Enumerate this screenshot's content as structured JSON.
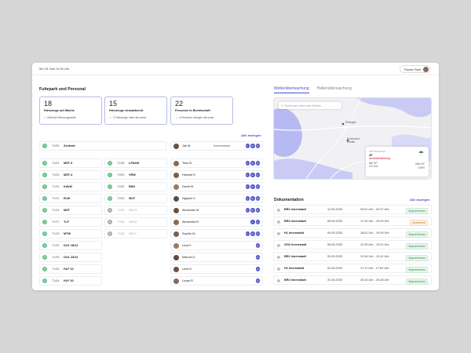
{
  "header": {
    "datetime": "Mo 15. Mai  14:40 Uhr",
    "user": "Florian Seel"
  },
  "fleet": {
    "title": "Fuhrpark und Personal",
    "link_all": "Alle anzeigen",
    "stats": [
      {
        "num": "18",
        "label": "Fahrzeuge auf Wache",
        "sub": "Gleiche Fahrzeuganzahl",
        "icon": "="
      },
      {
        "num": "15",
        "label": "Fahrzeuge einsatzbereit",
        "sub": "2 Fahrzeuge mehr als sonst",
        "icon": "↗"
      },
      {
        "num": "22",
        "label": "Personen in Bereitschaft",
        "sub": "4 Personen weniger als sonst",
        "icon": "↘"
      }
    ],
    "vehicles_left": [
      {
        "code": "71/00",
        "name": "Zentrale",
        "status": "1"
      },
      {
        "code": "71/01",
        "name": "MZF-3",
        "status": "2"
      },
      {
        "code": "71/02",
        "name": "MZF-4",
        "status": "2"
      },
      {
        "code": "71/10",
        "name": "KdoW",
        "status": "2"
      },
      {
        "code": "71/11",
        "name": "ELW",
        "status": "2"
      },
      {
        "code": "71/14",
        "name": "MZF",
        "status": "2"
      },
      {
        "code": "71/17",
        "name": "TLF",
        "status": "2"
      },
      {
        "code": "71/19",
        "name": "MTW",
        "status": "2"
      },
      {
        "code": "71/32",
        "name": "DLK 18/12",
        "status": "2"
      },
      {
        "code": "71/33",
        "name": "DLK 23/12",
        "status": "2"
      },
      {
        "code": "71/42",
        "name": "HLF 10",
        "status": "2"
      },
      {
        "code": "71/44",
        "name": "HLF 20",
        "status": "2"
      }
    ],
    "vehicles_right": [
      {
        "code": "71/45",
        "name": "LFKatS",
        "status": "2",
        "muted": false
      },
      {
        "code": "71/50",
        "name": "VRW",
        "status": "2",
        "muted": false
      },
      {
        "code": "71/52",
        "name": "RW2",
        "status": "2",
        "muted": false
      },
      {
        "code": "71/53",
        "name": "WLF",
        "status": "2",
        "muted": false
      },
      {
        "code": "71/54",
        "name": "GW-G",
        "status": "6",
        "muted": true
      },
      {
        "code": "71/55",
        "name": "GW-A",
        "status": "6",
        "muted": true
      },
      {
        "code": "71/56",
        "name": "GW-T",
        "status": "6",
        "muted": true
      }
    ],
    "personnel": [
      {
        "name": "Jan M.",
        "role": "Kommandant",
        "badges": [
          "L",
          "G",
          "A"
        ]
      },
      {
        "name": "Timo B.",
        "role": "",
        "badges": [
          "L",
          "G",
          "A"
        ]
      },
      {
        "name": "Hannah K.",
        "role": "",
        "badges": [
          "L",
          "G",
          "A"
        ]
      },
      {
        "name": "David W.",
        "role": "",
        "badges": [
          "L",
          "G",
          "A"
        ]
      },
      {
        "name": "Nguyen K.",
        "role": "",
        "badges": [
          "L",
          "G",
          "A"
        ]
      },
      {
        "name": "Alexander M.",
        "role": "",
        "badges": [
          "L",
          "G",
          "A"
        ]
      },
      {
        "name": "Alexandra R.",
        "role": "",
        "badges": [
          "L",
          "A"
        ]
      },
      {
        "name": "Sophie W.",
        "role": "",
        "badges": [
          "L",
          "G",
          "A"
        ]
      },
      {
        "name": "Luca F.",
        "role": "",
        "badges": [
          "A"
        ]
      },
      {
        "name": "Manuel G.",
        "role": "",
        "badges": [
          "A"
        ]
      },
      {
        "name": "Lena K.",
        "role": "",
        "badges": [
          "A"
        ]
      },
      {
        "name": "Lucas R.",
        "role": "",
        "badges": [
          "A"
        ]
      }
    ]
  },
  "weather": {
    "tab_active": "Wetterüberwachung",
    "tab_other": "Hallenüberwachung",
    "search_placeholder": "Suche nach Orten oder Straßen",
    "towns": [
      "Pfullingen",
      "Schorndorf-Gestell"
    ],
    "card_label": "WETTERDATEN",
    "temp": "26°",
    "warning": "Unwetterwarnung",
    "min": "Min 22°",
    "wind": "20 L/m2",
    "max": "Max 26°",
    "rain": "100%"
  },
  "docs": {
    "title": "Dokumentation",
    "link_all": "Alle anzeigen",
    "rows": [
      {
        "name": "BR2 Innenstadt",
        "date": "12.05.2025",
        "time": "03:01 Uhr - 04:37 Uhr",
        "status": "Abgeschlossen",
        "warn": false
      },
      {
        "name": "BR4 Innenstadt",
        "date": "08.05.2025",
        "time": "17:44 Uhr - 23:49 Uhr",
        "status": "Ausstehend",
        "warn": true
      },
      {
        "name": "H1 Innenstadt",
        "date": "09.05.2025",
        "time": "18:01 Uhr - 19:05 Uhr",
        "status": "Abgeschlossen",
        "warn": false
      },
      {
        "name": "GG2 Innenstadt",
        "date": "06.05.2025",
        "time": "12:35 Uhr - 13:21 Uhr",
        "status": "Abgeschlossen",
        "warn": false
      },
      {
        "name": "BR1 Innenstadt",
        "date": "03.05.2025",
        "time": "12:04 Uhr - 12:41 Uhr",
        "status": "Abgeschlossen",
        "warn": false
      },
      {
        "name": "H1 Innenstadt",
        "date": "02.05.2025",
        "time": "17:11 Uhr - 17:54 Uhr",
        "status": "Abgeschlossen",
        "warn": false
      },
      {
        "name": "BR2 Innenstadt",
        "date": "31.05.2025",
        "time": "20:15 Uhr - 20:48 Uhr",
        "status": "Abgeschlossen",
        "warn": false
      }
    ]
  }
}
